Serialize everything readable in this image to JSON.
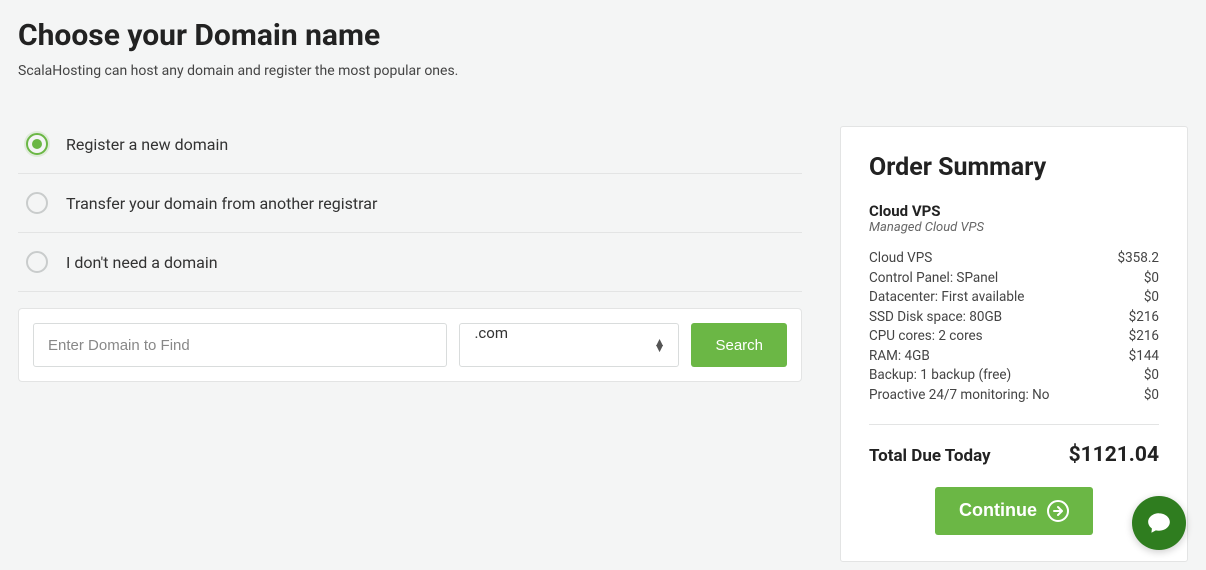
{
  "header": {
    "title": "Choose your Domain name",
    "subtitle": "ScalaHosting can host any domain and register the most popular ones."
  },
  "options": [
    {
      "label": "Register a new domain",
      "selected": true
    },
    {
      "label": "Transfer your domain from another registrar",
      "selected": false
    },
    {
      "label": "I don't need a domain",
      "selected": false
    }
  ],
  "search": {
    "placeholder": "Enter Domain to Find",
    "tld": ".com",
    "button": "Search"
  },
  "summary": {
    "title": "Order Summary",
    "product": "Cloud VPS",
    "product_sub": "Managed Cloud VPS",
    "items": [
      {
        "label": "Cloud VPS",
        "price": "$358.2"
      },
      {
        "label": "Control Panel: SPanel",
        "price": "$0"
      },
      {
        "label": "Datacenter: First available",
        "price": "$0"
      },
      {
        "label": "SSD Disk space: 80GB",
        "price": "$216"
      },
      {
        "label": "CPU cores: 2 cores",
        "price": "$216"
      },
      {
        "label": "RAM: 4GB",
        "price": "$144"
      },
      {
        "label": "Backup: 1 backup (free)",
        "price": "$0"
      },
      {
        "label": "Proactive 24/7 monitoring: No",
        "price": "$0"
      }
    ],
    "total_label": "Total Due Today",
    "total_value": "$1121.04",
    "continue": "Continue"
  },
  "colors": {
    "accent": "#6bb745",
    "chat": "#2f7d1f"
  }
}
